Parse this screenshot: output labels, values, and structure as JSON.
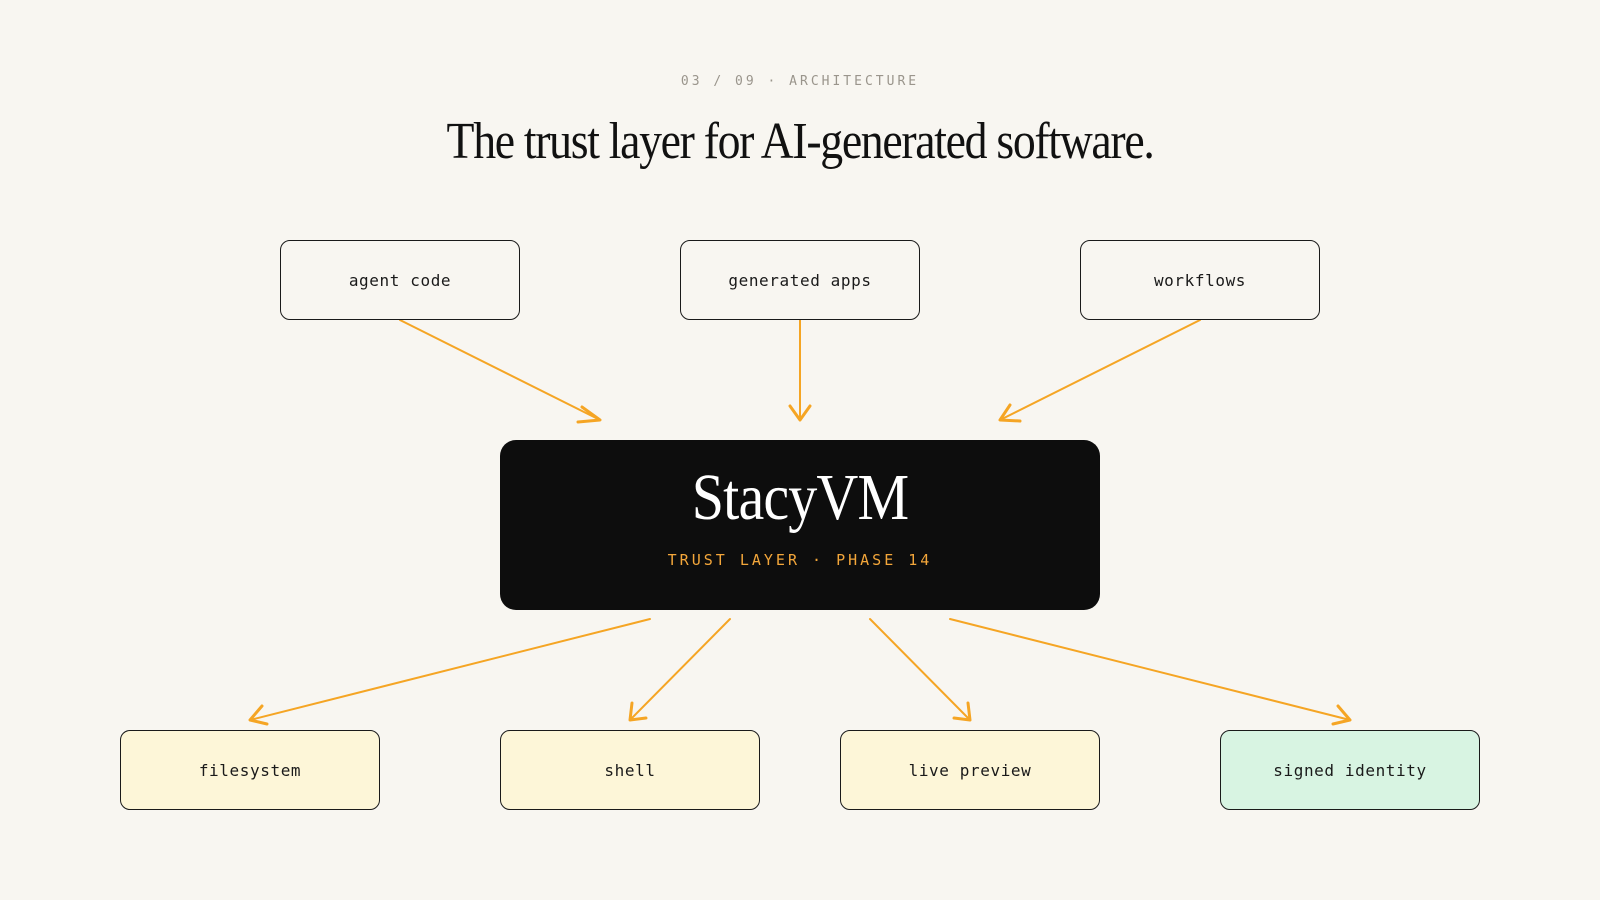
{
  "header": {
    "eyebrow": "03 / 09 · ARCHITECTURE",
    "title": "The trust layer for AI-generated software."
  },
  "inputs": [
    {
      "label": "agent code"
    },
    {
      "label": "generated apps"
    },
    {
      "label": "workflows"
    }
  ],
  "core": {
    "title": "StacyVM",
    "subtitle": "TRUST LAYER · PHASE 14"
  },
  "outputs": [
    {
      "label": "filesystem"
    },
    {
      "label": "shell"
    },
    {
      "label": "live preview"
    },
    {
      "label": "signed identity"
    }
  ],
  "colors": {
    "background": "#f8f6f1",
    "arrow": "#f5a524",
    "core_fill": "#0d0d0d",
    "core_subtitle": "#f3a63a",
    "output_fill": "#fdf6d8",
    "identity_fill": "#d8f4e2"
  }
}
